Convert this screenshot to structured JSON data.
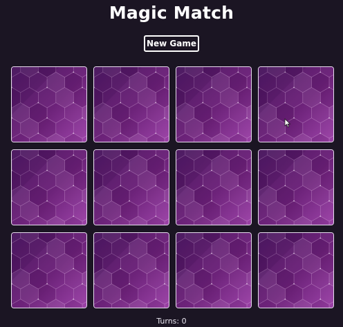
{
  "app": {
    "title": "Magic Match"
  },
  "controls": {
    "new_game_label": "New Game"
  },
  "board": {
    "rows": 3,
    "columns": 4,
    "cards": [
      {
        "state": "face-down",
        "back": "purple-hexagon-pattern"
      },
      {
        "state": "face-down",
        "back": "purple-hexagon-pattern"
      },
      {
        "state": "face-down",
        "back": "purple-hexagon-pattern"
      },
      {
        "state": "face-down",
        "back": "purple-hexagon-pattern"
      },
      {
        "state": "face-down",
        "back": "purple-hexagon-pattern"
      },
      {
        "state": "face-down",
        "back": "purple-hexagon-pattern"
      },
      {
        "state": "face-down",
        "back": "purple-hexagon-pattern"
      },
      {
        "state": "face-down",
        "back": "purple-hexagon-pattern"
      },
      {
        "state": "face-down",
        "back": "purple-hexagon-pattern"
      },
      {
        "state": "face-down",
        "back": "purple-hexagon-pattern"
      },
      {
        "state": "face-down",
        "back": "purple-hexagon-pattern"
      },
      {
        "state": "face-down",
        "back": "purple-hexagon-pattern"
      }
    ]
  },
  "status": {
    "turns_label": "Turns: 0"
  },
  "colors": {
    "background": "#1b1523",
    "card_base": "#6b1f78",
    "card_light": "#9a3fa6",
    "card_dark": "#4a1660",
    "card_border": "#e8dcef",
    "text": "#ffffff"
  }
}
